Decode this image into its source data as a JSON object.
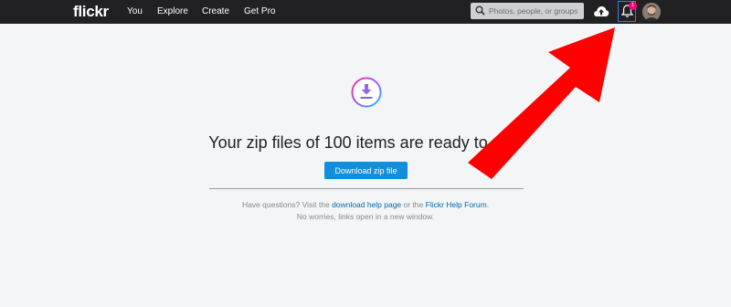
{
  "header": {
    "logo": "flickr",
    "nav": [
      "You",
      "Explore",
      "Create",
      "Get Pro"
    ],
    "search_placeholder": "Photos, people, or groups",
    "notification_count": "1"
  },
  "main": {
    "title": "Your zip files of 100 items are ready to dow",
    "download_button": "Download zip file",
    "help_prefix": "Have questions? Visit the ",
    "help_link_1": "download help page",
    "help_middle": " or the ",
    "help_link_2": "Flickr Help Forum",
    "help_suffix": ".",
    "help_line_2": "No worries, links open in a new window."
  },
  "icons": {
    "search": "search-icon",
    "upload": "cloud-upload-icon",
    "notification": "bell-icon",
    "download": "download-icon",
    "annotation": "red-arrow"
  },
  "colors": {
    "topbar": "#212124",
    "button": "#128fdc",
    "link": "#006dac",
    "badge": "#ff0084",
    "arrow": "#ff0000"
  }
}
